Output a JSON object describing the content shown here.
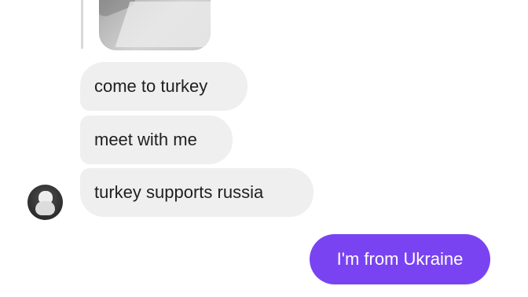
{
  "conversation": {
    "incoming": [
      {
        "text": "come to turkey"
      },
      {
        "text": "meet with me"
      },
      {
        "text": "turkey supports russia"
      }
    ],
    "outgoing": [
      {
        "text": "I'm from Ukraine"
      }
    ]
  },
  "theme": {
    "incoming_bubble": "#efefef",
    "outgoing_bubble": "#7a43f2",
    "incoming_text": "#1f1f1f",
    "outgoing_text": "#ffffff"
  },
  "attachments": {
    "reply_image_icon": "image-icon",
    "avatar_icon": "avatar"
  }
}
